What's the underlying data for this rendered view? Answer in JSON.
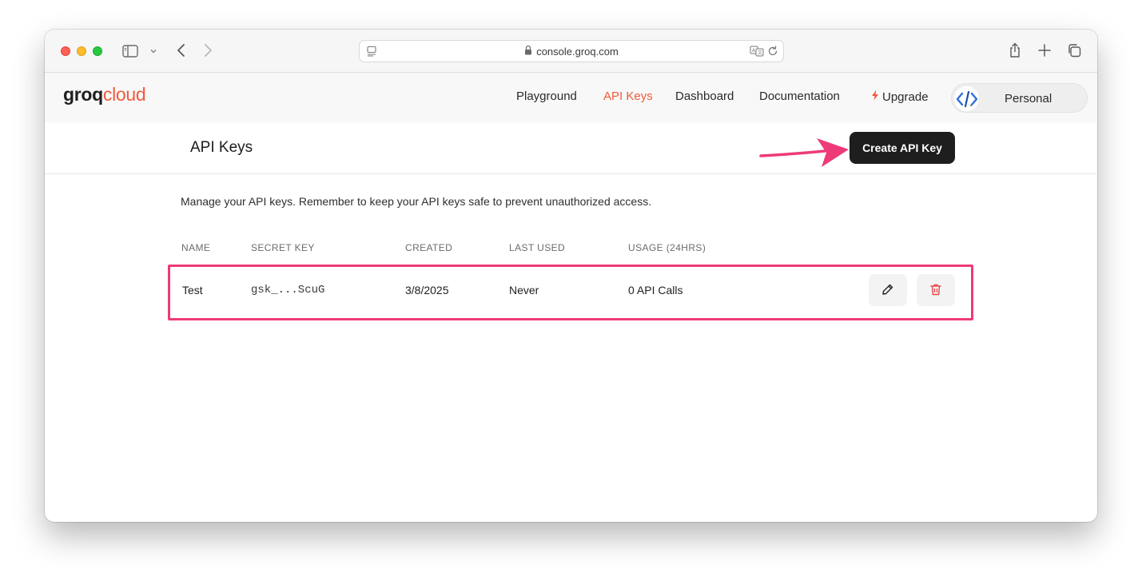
{
  "browser": {
    "url": "console.groq.com"
  },
  "app": {
    "logo_groq": "groq",
    "logo_cloud": "cloud",
    "nav": {
      "playground": "Playground",
      "api_keys": "API Keys",
      "dashboard": "Dashboard",
      "documentation": "Documentation",
      "upgrade": "Upgrade"
    },
    "account": "Personal"
  },
  "page": {
    "title": "API Keys",
    "create_button": "Create API Key",
    "description": "Manage your API keys. Remember to keep your API keys safe to prevent unauthorized access."
  },
  "table": {
    "headers": [
      "NAME",
      "SECRET KEY",
      "CREATED",
      "LAST USED",
      "USAGE (24HRS)"
    ],
    "rows": [
      {
        "name": "Test",
        "secret": "gsk_...ScuG",
        "created": "3/8/2025",
        "last_used": "Never",
        "usage": "0 API Calls"
      }
    ]
  },
  "colors": {
    "accent": "#f05a3a",
    "highlight": "#ee3a79",
    "button_dark": "#1e1e1e",
    "delete_red": "#e5484d"
  }
}
